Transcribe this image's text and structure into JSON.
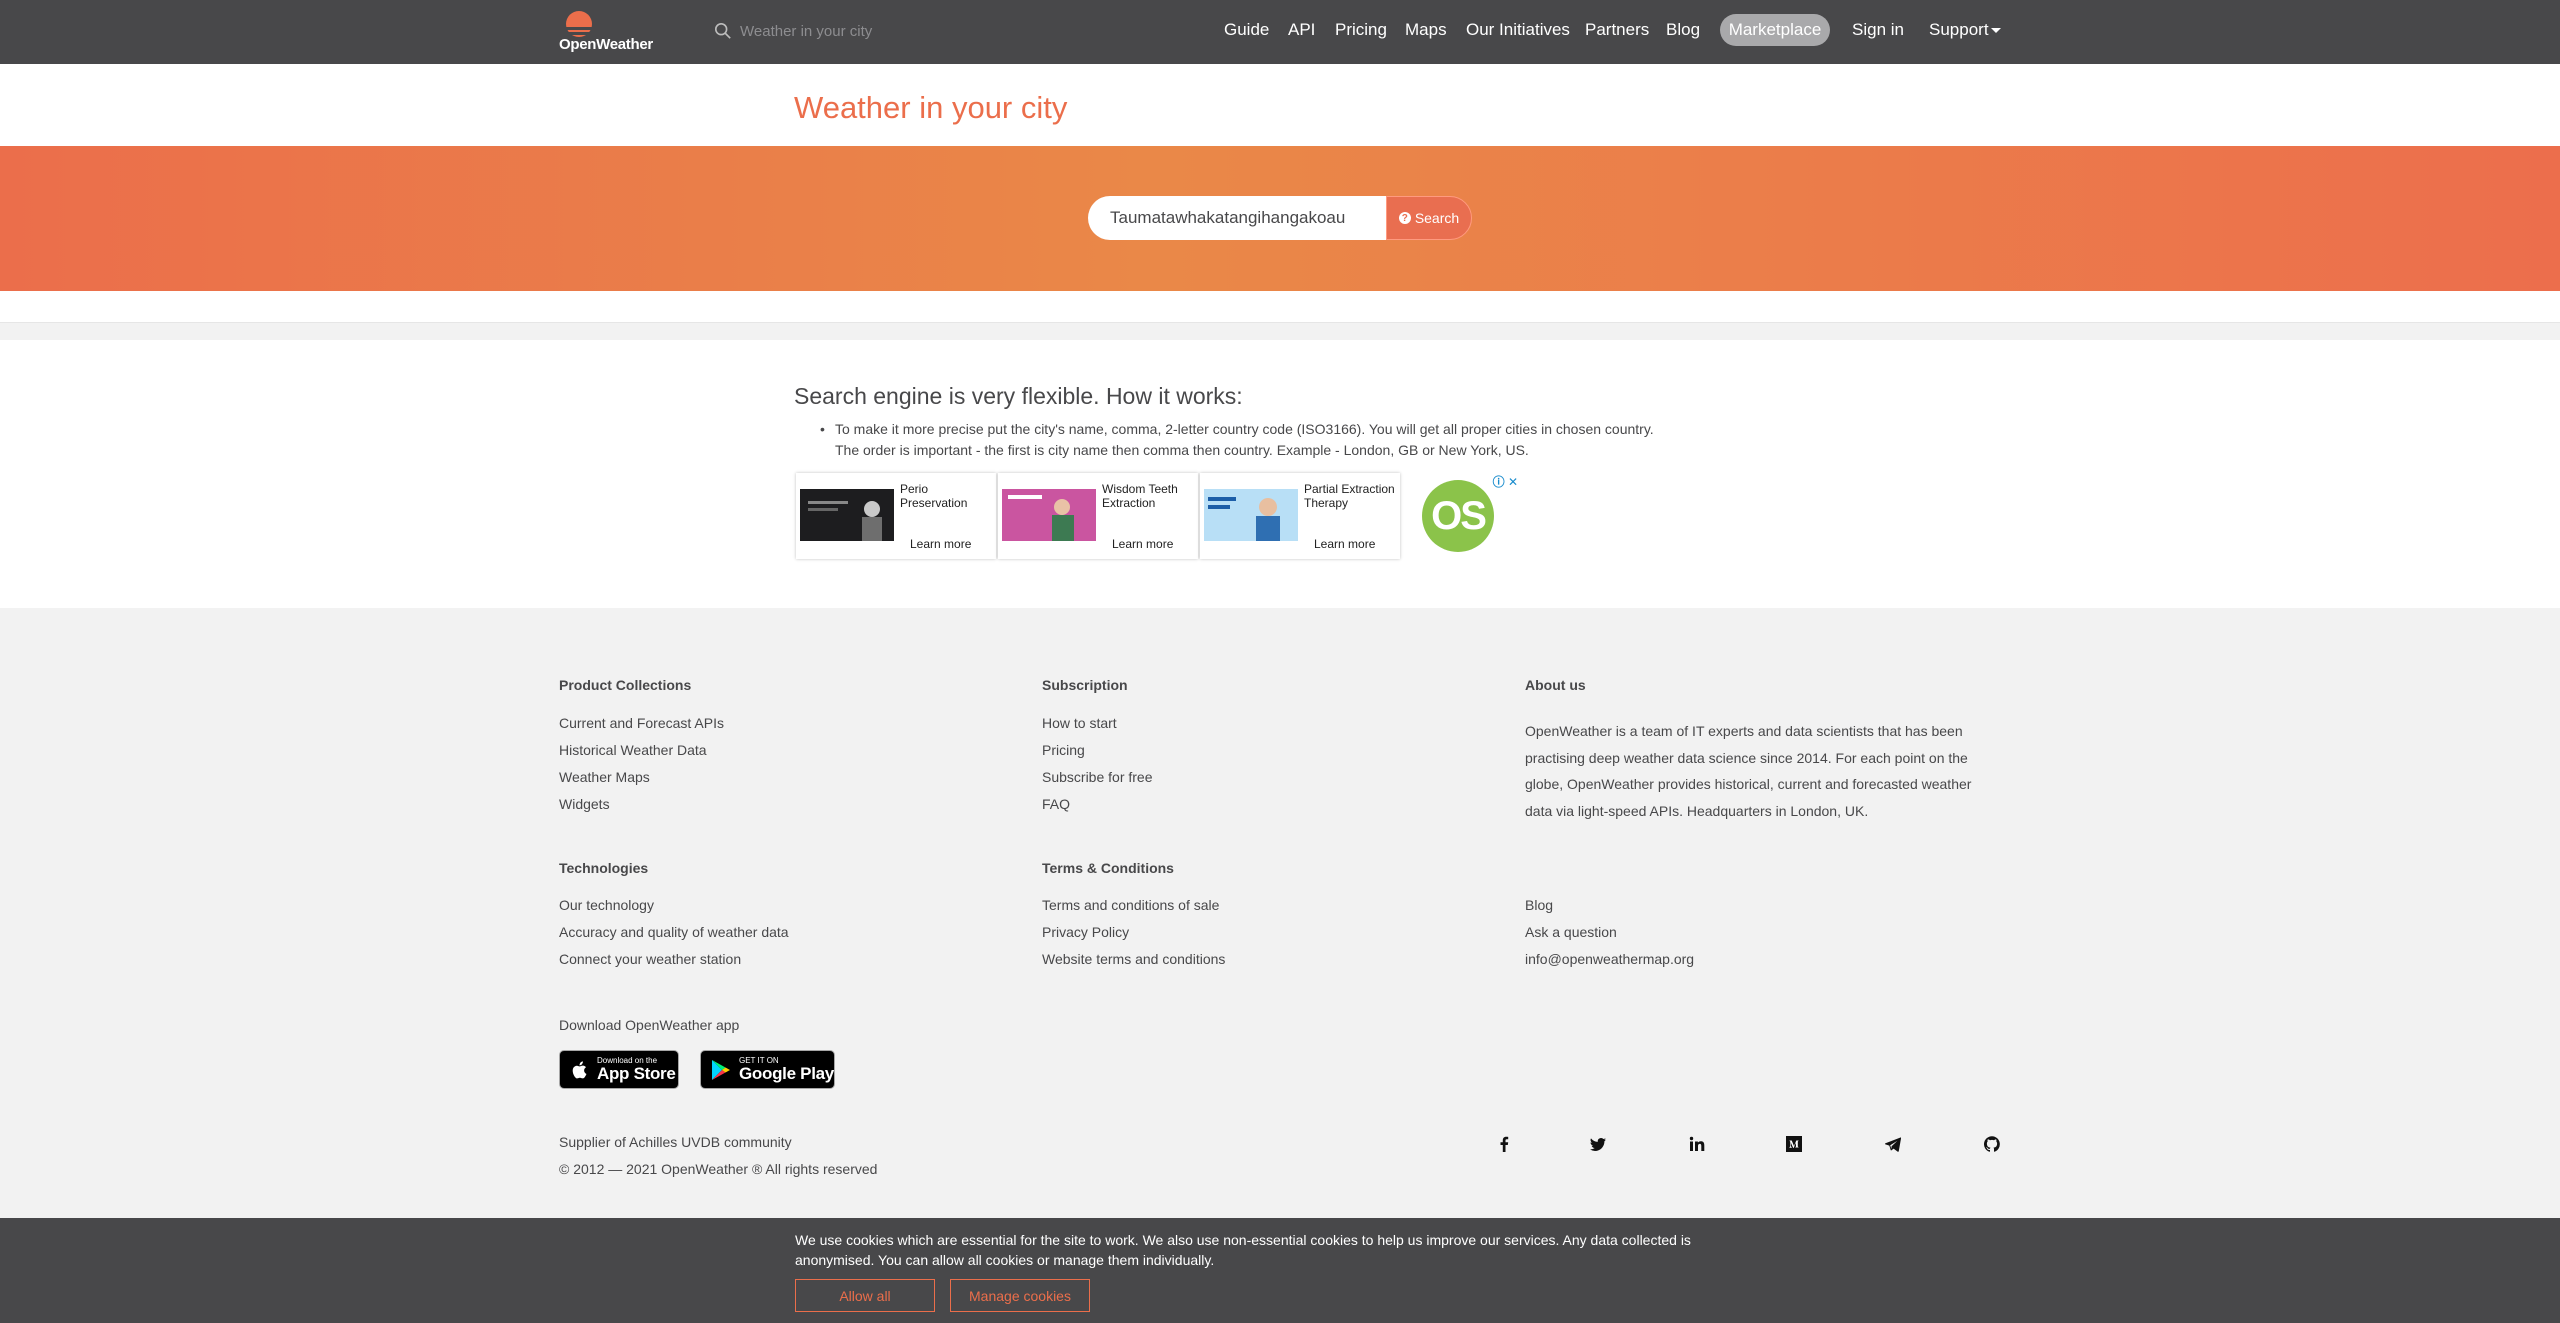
{
  "header": {
    "logo_text": "OpenWeather",
    "search_placeholder": "Weather in your city",
    "nav": [
      "Guide",
      "API",
      "Pricing",
      "Maps",
      "Our Initiatives",
      "Partners",
      "Blog"
    ],
    "marketplace": "Marketplace",
    "signin": "Sign in",
    "support": "Support"
  },
  "main": {
    "title": "Weather in your city",
    "search_value": "Taumatawhakatangihangakoau",
    "search_button": "Search",
    "how_title": "Search engine is very flexible. How it works:",
    "how_line1": "To make it more precise put the city's name, comma, 2-letter country code (ISO3166). You will get all proper cities in chosen country.",
    "how_line2": "The order is important - the first is city name then comma then country. Example - London, GB or New York, US."
  },
  "ads": [
    {
      "title": "Perio Preservation",
      "cta": "Learn more"
    },
    {
      "title": "Wisdom Teeth Extraction",
      "cta": "Learn more"
    },
    {
      "title": "Partial Extraction Therapy",
      "cta": "Learn more"
    }
  ],
  "ad_logo_text": "OS",
  "footer": {
    "product_title": "Product Collections",
    "product_links": [
      "Current and Forecast APIs",
      "Historical Weather Data",
      "Weather Maps",
      "Widgets"
    ],
    "subscription_title": "Subscription",
    "subscription_links": [
      "How to start",
      "Pricing",
      "Subscribe for free",
      "FAQ"
    ],
    "about_title": "About us",
    "about_text": "OpenWeather is a team of IT experts and data scientists that has been practising deep weather data science since 2014. For each point on the globe, OpenWeather provides historical, current and forecasted weather data via light-speed APIs. Headquarters in London, UK.",
    "tech_title": "Technologies",
    "tech_links": [
      "Our technology",
      "Accuracy and quality of weather data",
      "Connect your weather station"
    ],
    "terms_title": "Terms & Conditions",
    "terms_links": [
      "Terms and conditions of sale",
      "Privacy Policy",
      "Website terms and conditions"
    ],
    "misc_links": [
      "Blog",
      "Ask a question",
      "info@openweathermap.org"
    ],
    "download_label": "Download OpenWeather app",
    "appstore_small": "Download on the",
    "appstore_big": "App Store",
    "googleplay_small": "GET IT ON",
    "googleplay_big": "Google Play",
    "supplier": "Supplier of Achilles UVDB community",
    "copyright": "© 2012 — 2021 OpenWeather ® All rights reserved",
    "social_icons": [
      "facebook-icon",
      "twitter-icon",
      "linkedin-icon",
      "medium-icon",
      "telegram-icon",
      "github-icon"
    ]
  },
  "cookie": {
    "text": "We use cookies which are essential for the site to work. We also use non-essential cookies to help us improve our services. Any data collected is anonymised. You can allow all cookies or manage them individually.",
    "allow": "Allow all",
    "manage": "Manage cookies"
  },
  "colors": {
    "brand_orange": "#eb6e4b",
    "header_bg": "#48484a",
    "footer_bg": "#f2f2f2"
  }
}
